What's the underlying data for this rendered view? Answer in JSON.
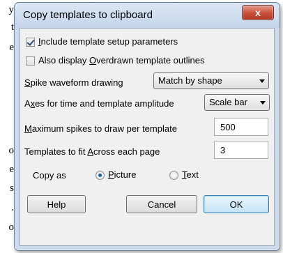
{
  "background_text": [
    "y",
    "t",
    "e",
    "o",
    "e",
    "s",
    ".",
    "o"
  ],
  "dialog": {
    "title": "Copy templates to clipboard",
    "close_label": "x",
    "include_setup": {
      "pre": "",
      "key": "I",
      "post": "nclude template setup parameters",
      "checked": true
    },
    "overdrawn": {
      "pre": "Also display ",
      "key": "O",
      "post": "verdrawn template outlines",
      "checked": false
    },
    "spike_drawing": {
      "key": "S",
      "post": "pike waveform drawing",
      "value": "Match by shape"
    },
    "axes": {
      "pre": "A",
      "key": "x",
      "post": "es for time and template amplitude",
      "value": "Scale bar"
    },
    "max_spikes": {
      "key": "M",
      "post": "aximum spikes to draw per template",
      "value": "500"
    },
    "templates_across": {
      "pre": "Templates to fit ",
      "key": "A",
      "post": "cross each page",
      "value": "3"
    },
    "copy_as": {
      "label": "Copy as",
      "picture": {
        "key": "P",
        "post": "icture",
        "checked": true
      },
      "text": {
        "key": "T",
        "post": "ext",
        "checked": false
      }
    },
    "buttons": {
      "help": "Help",
      "cancel": "Cancel",
      "ok": "OK"
    }
  },
  "colors": {
    "title_bar": "#c4d5ea",
    "client": "#f0f0f0",
    "close": "#c9503a"
  }
}
